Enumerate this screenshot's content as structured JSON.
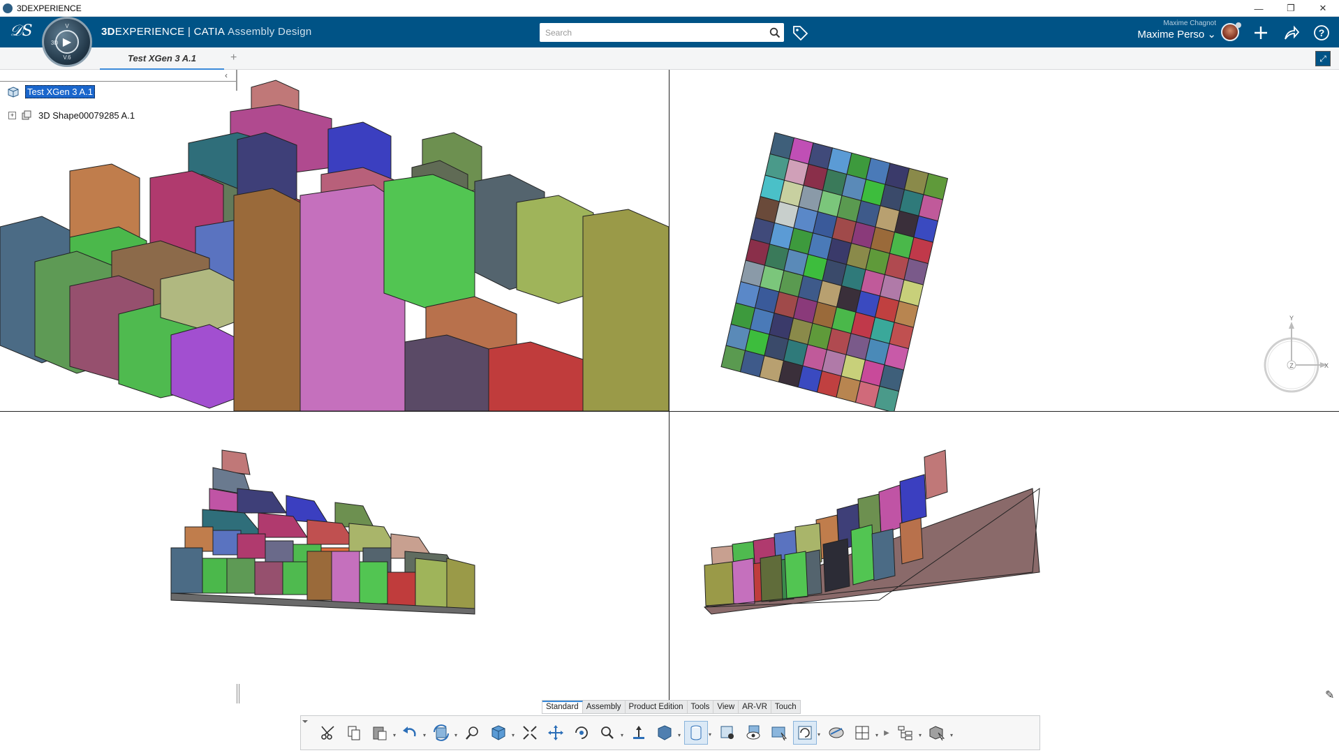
{
  "window": {
    "title": "3DEXPERIENCE",
    "controls": [
      "minimize",
      "restore",
      "close"
    ]
  },
  "header": {
    "brand_prefix": "3D",
    "brand_main": "EXPERIENCE | CATIA",
    "app_name": "Assembly Design",
    "compass_version": "V.6",
    "search_placeholder": "Search",
    "user_small": "Maxime Chagnot",
    "user_name": "Maxime Perso",
    "icons": [
      "tag-icon",
      "add-icon",
      "share-icon",
      "help-icon"
    ]
  },
  "tabs": [
    {
      "label": "Test XGen 3 A.1",
      "active": true
    }
  ],
  "tree": {
    "root": {
      "label": "Test XGen 3 A.1",
      "selected": true
    },
    "children": [
      {
        "label": "3D Shape00079285 A.1",
        "collapsed": true
      }
    ]
  },
  "viewport_axes": {
    "y": "Y",
    "z": "Z",
    "x": "X"
  },
  "actionbar": {
    "sections": [
      {
        "label": "Standard",
        "active": true
      },
      {
        "label": "Assembly",
        "active": false
      },
      {
        "label": "Product Edition",
        "active": false
      },
      {
        "label": "Tools",
        "active": false
      },
      {
        "label": "View",
        "active": false
      },
      {
        "label": "AR-VR",
        "active": false
      },
      {
        "label": "Touch",
        "active": false
      }
    ],
    "tools": [
      "cut-icon",
      "copy-icon",
      "paste-icon",
      "undo-icon",
      "update-icon",
      "zoom-area-icon",
      "view-cube-icon",
      "fit-all-icon",
      "pan-icon",
      "rotate-icon",
      "zoom-icon",
      "normal-view-icon",
      "render-style-icon",
      "cylinder-icon",
      "view-mode-icon",
      "hide-show-icon",
      "swap-visible-icon",
      "selection-mode-icon",
      "multi-view-icon",
      "layout-icon",
      "tree-icon",
      "3d-annotation-icon"
    ]
  },
  "colors": {
    "header": "#005386",
    "selection": "#1a66cc",
    "active_tab": "#3b8ad9"
  }
}
